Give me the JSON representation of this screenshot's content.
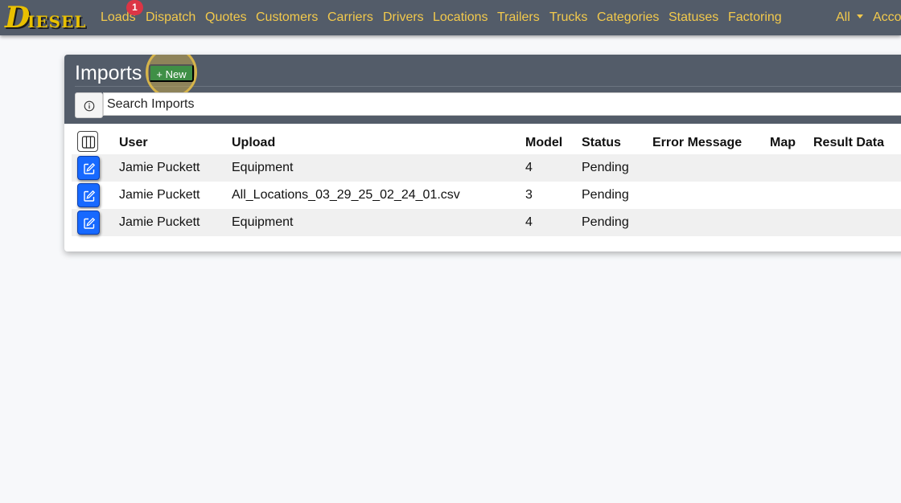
{
  "brand": {
    "logo_first": "D",
    "logo_rest": "IESEL"
  },
  "nav": {
    "items": [
      {
        "label": "Loads",
        "badge": "1"
      },
      {
        "label": "Dispatch"
      },
      {
        "label": "Quotes"
      },
      {
        "label": "Customers"
      },
      {
        "label": "Carriers"
      },
      {
        "label": "Drivers"
      },
      {
        "label": "Locations"
      },
      {
        "label": "Trailers"
      },
      {
        "label": "Trucks"
      },
      {
        "label": "Categories"
      },
      {
        "label": "Statuses"
      },
      {
        "label": "Factoring"
      }
    ],
    "scope": "All",
    "account": "Acco"
  },
  "page": {
    "title": "Imports",
    "new_label": "+ New",
    "search_placeholder": "Search Imports"
  },
  "table": {
    "columns": [
      "User",
      "Upload",
      "Model",
      "Status",
      "Error Message",
      "Map",
      "Result Data"
    ],
    "rows": [
      {
        "user": "Jamie Puckett",
        "upload": "Equipment",
        "model": "4",
        "status": "Pending",
        "error": "",
        "map": "",
        "result": ""
      },
      {
        "user": "Jamie Puckett",
        "upload": "All_Locations_03_29_25_02_24_01.csv",
        "model": "3",
        "status": "Pending",
        "error": "",
        "map": "",
        "result": ""
      },
      {
        "user": "Jamie Puckett",
        "upload": "Equipment",
        "model": "4",
        "status": "Pending",
        "error": "",
        "map": "",
        "result": ""
      }
    ]
  },
  "colors": {
    "navbar": "#535c69",
    "nav_link": "#f2c94c",
    "badge": "#dc3545",
    "new_button": "#3f8f46",
    "edit_button": "#1769ff",
    "highlight": "#d6b44a"
  },
  "icons": {
    "info": "info-circle-icon",
    "columns": "columns-icon",
    "edit": "pencil-square-icon",
    "dropdown": "caret-down-icon"
  }
}
